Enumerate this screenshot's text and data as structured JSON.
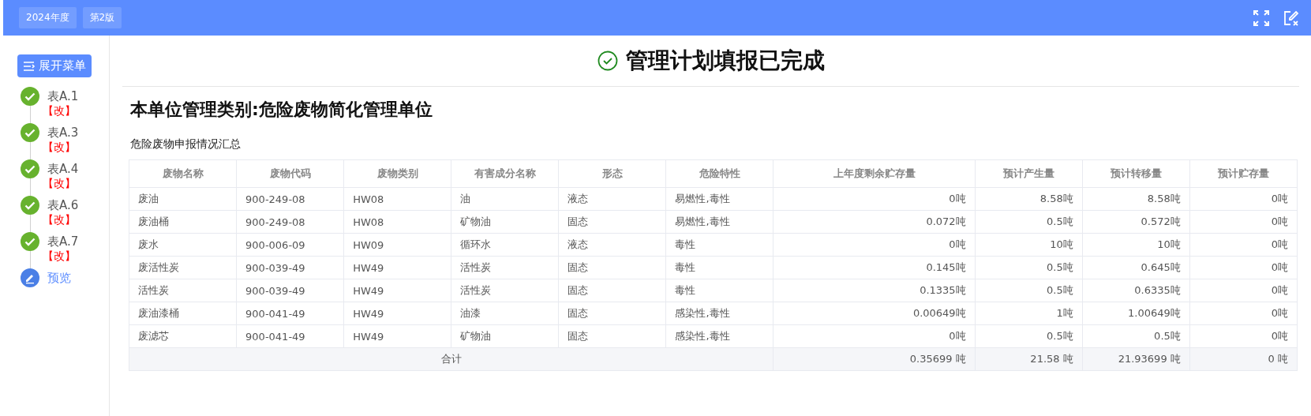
{
  "top_bar": {
    "tags": [
      "2024年度",
      "第2版"
    ]
  },
  "sidebar": {
    "menu_button": "展开菜单",
    "steps": [
      {
        "label": "表A.1",
        "note": "【改】",
        "kind": "done"
      },
      {
        "label": "表A.3",
        "note": "【改】",
        "kind": "done"
      },
      {
        "label": "表A.4",
        "note": "【改】",
        "kind": "done"
      },
      {
        "label": "表A.6",
        "note": "【改】",
        "kind": "done"
      },
      {
        "label": "表A.7",
        "note": "【改】",
        "kind": "done"
      },
      {
        "label": "预览",
        "kind": "current"
      }
    ]
  },
  "status_title": "管理计划填报已完成",
  "heading": "本单位管理类别:危险废物简化管理单位",
  "section_title": "危险废物申报情况汇总",
  "table": {
    "columns": [
      "废物名称",
      "废物代码",
      "废物类别",
      "有害成分名称",
      "形态",
      "危险特性",
      "上年度剩余贮存量",
      "预计产生量",
      "预计转移量",
      "预计贮存量"
    ],
    "rows": [
      [
        "废油",
        "900-249-08",
        "HW08",
        "油",
        "液态",
        "易燃性,毒性",
        "0吨",
        "8.58吨",
        "8.58吨",
        "0吨"
      ],
      [
        "废油桶",
        "900-249-08",
        "HW08",
        "矿物油",
        "固态",
        "易燃性,毒性",
        "0.072吨",
        "0.5吨",
        "0.572吨",
        "0吨"
      ],
      [
        "废水",
        "900-006-09",
        "HW09",
        "循环水",
        "液态",
        "毒性",
        "0吨",
        "10吨",
        "10吨",
        "0吨"
      ],
      [
        "废活性炭",
        "900-039-49",
        "HW49",
        "活性炭",
        "固态",
        "毒性",
        "0.145吨",
        "0.5吨",
        "0.645吨",
        "0吨"
      ],
      [
        "活性炭",
        "900-039-49",
        "HW49",
        "活性炭",
        "固态",
        "毒性",
        "0.1335吨",
        "0.5吨",
        "0.6335吨",
        "0吨"
      ],
      [
        "废油漆桶",
        "900-041-49",
        "HW49",
        "油漆",
        "固态",
        "感染性,毒性",
        "0.00649吨",
        "1吨",
        "1.00649吨",
        "0吨"
      ],
      [
        "废滤芯",
        "900-041-49",
        "HW49",
        "矿物油",
        "固态",
        "感染性,毒性",
        "0吨",
        "0.5吨",
        "0.5吨",
        "0吨"
      ]
    ],
    "total": {
      "label": "合计",
      "values": [
        "0.35699 吨",
        "21.58 吨",
        "21.93699 吨",
        "0 吨"
      ]
    }
  }
}
